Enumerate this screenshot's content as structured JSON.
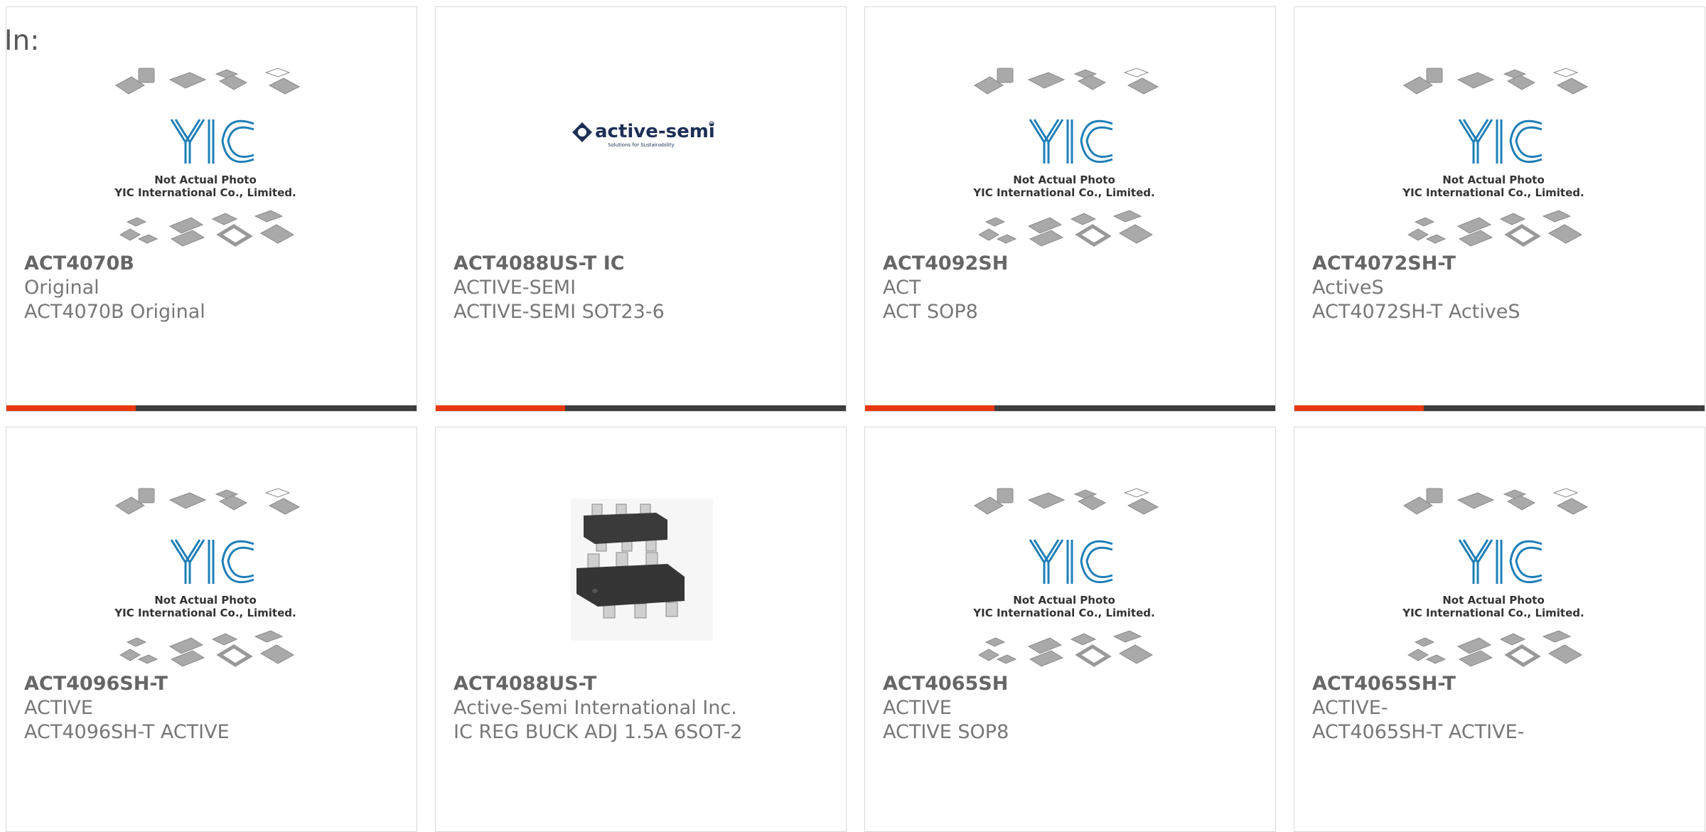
{
  "header": {
    "label": "In:"
  },
  "colors": {
    "accent": "#e8380d",
    "bar": "#3d3d3d",
    "text": "#666666",
    "border": "#d9d9d9"
  },
  "placeholder_photo": {
    "line1": "Not Actual Photo",
    "line2": "YIC International Co., Limited.",
    "logo": "YIC"
  },
  "brand_logo": {
    "name": "active-semi",
    "tagline": "Solutions for Sustainability"
  },
  "products": [
    {
      "title": "ACT4070B",
      "line1": "Original",
      "line2": "ACT4070B Original",
      "image": "placeholder"
    },
    {
      "title": "ACT4088US-T IC",
      "line1": "ACTIVE-SEMI",
      "line2": "ACTIVE-SEMI SOT23-6",
      "image": "active-semi-logo"
    },
    {
      "title": "ACT4092SH",
      "line1": "ACT",
      "line2": "ACT SOP8",
      "image": "placeholder"
    },
    {
      "title": "ACT4072SH-T",
      "line1": "ActiveS",
      "line2": "ACT4072SH-T ActiveS",
      "image": "placeholder"
    },
    {
      "title": "ACT4096SH-T",
      "line1": "ACTIVE",
      "line2": "ACT4096SH-T ACTIVE",
      "image": "placeholder"
    },
    {
      "title": "ACT4088US-T",
      "line1": "Active-Semi International Inc.",
      "line2": "IC REG BUCK ADJ 1.5A 6SOT-2",
      "image": "sot23-6-chip-photo"
    },
    {
      "title": "ACT4065SH",
      "line1": "ACTIVE",
      "line2": "ACTIVE SOP8",
      "image": "placeholder"
    },
    {
      "title": "ACT4065SH-T",
      "line1": "ACTIVE-",
      "line2": "ACT4065SH-T ACTIVE-",
      "image": "placeholder"
    }
  ]
}
